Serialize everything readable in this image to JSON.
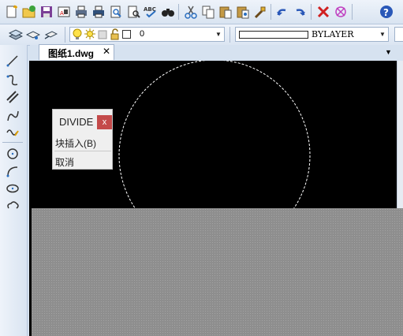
{
  "toolbar": {
    "icons": [
      "new-file-icon",
      "open-file-icon",
      "save-icon",
      "print-preview-icon",
      "print-icon",
      "printer-icon",
      "page-setup-icon",
      "preview-icon",
      "spellcheck-icon",
      "find-icon",
      "cut-icon",
      "copy-icon",
      "paste-icon",
      "paste-special-icon",
      "match-properties-icon",
      "undo-icon",
      "redo-icon",
      "delete-icon",
      "erase-icon",
      "help-icon"
    ]
  },
  "layer_bar": {
    "layer_value": "0",
    "linetype_value": "BYLAYER"
  },
  "tab": {
    "filename": "图纸1.dwg",
    "close": "✕",
    "dropdown": "▼"
  },
  "divide_panel": {
    "title": "DIVIDE",
    "close": "x",
    "option_block": "块插入(B)",
    "option_cancel": "取消"
  },
  "colors": {
    "canvas": "#000000",
    "close_button": "#c44a4a",
    "hidden_area": "#8e8e8e"
  }
}
